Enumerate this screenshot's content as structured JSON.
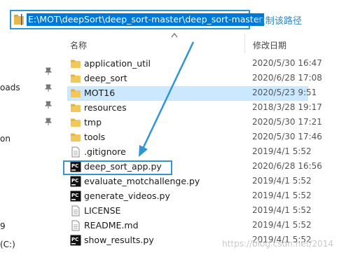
{
  "address_bar": {
    "path": "E:\\MOT\\deepSort\\deep_sort-master\\deep_sort-master",
    "copy_label": "复制该路径"
  },
  "columns": {
    "name": "名称",
    "date": "修改日期"
  },
  "sidebar": {
    "fragments": [
      "oads",
      "on",
      "9",
      "(C:)"
    ]
  },
  "files": [
    {
      "name": "application_util",
      "date": "2020/5/30 16:47",
      "type": "folder"
    },
    {
      "name": "deep_sort",
      "date": "2020/6/28 17:08",
      "type": "folder"
    },
    {
      "name": "MOT16",
      "date": "2020/5/23 9:51",
      "type": "folder",
      "selected": true
    },
    {
      "name": "resources",
      "date": "2018/3/28 19:17",
      "type": "folder"
    },
    {
      "name": "tmp",
      "date": "2020/5/30 17:21",
      "type": "folder"
    },
    {
      "name": "tools",
      "date": "2020/5/30 17:46",
      "type": "folder"
    },
    {
      "name": ".gitignore",
      "date": "2019/4/1 5:52",
      "type": "file"
    },
    {
      "name": "deep_sort_app.py",
      "date": "2020/6/28 16:56",
      "type": "pycharm"
    },
    {
      "name": "evaluate_motchallenge.py",
      "date": "2019/4/1 5:52",
      "type": "pycharm"
    },
    {
      "name": "generate_videos.py",
      "date": "2019/4/1 5:52",
      "type": "pycharm"
    },
    {
      "name": "LICENSE",
      "date": "2019/4/1 5:52",
      "type": "file"
    },
    {
      "name": "README.md",
      "date": "2019/4/1 5:52",
      "type": "file"
    },
    {
      "name": "show_results.py",
      "date": "2019/4/1 5:52",
      "type": "pycharm"
    }
  ],
  "watermark": "https://blog.csdn.net/2014",
  "colors": {
    "accent": "#2f95d3",
    "selection": "#cce8ff",
    "path_highlight": "#0078d7"
  }
}
